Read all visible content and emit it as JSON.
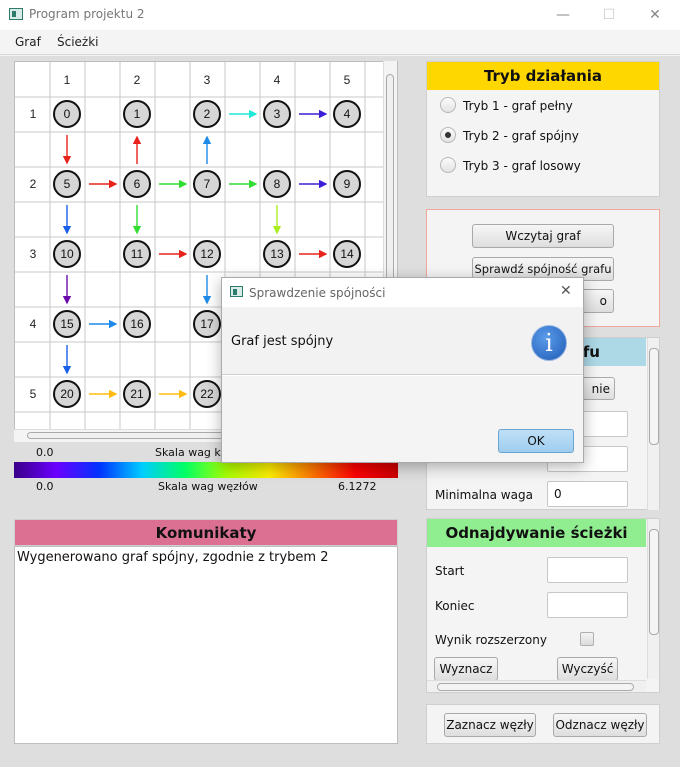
{
  "window": {
    "title": "Program projektu 2",
    "minimize": "—",
    "maximize": "☐",
    "close": "✕"
  },
  "menu": {
    "items": [
      "Graf",
      "Ścieżki"
    ]
  },
  "graph": {
    "col_labels": [
      "1",
      "2",
      "3",
      "4",
      "5"
    ],
    "row_labels": [
      "1",
      "2",
      "3",
      "4",
      "5"
    ],
    "nodes": [
      "0",
      "1",
      "2",
      "3",
      "4",
      "5",
      "6",
      "7",
      "8",
      "9",
      "10",
      "11",
      "12",
      "13",
      "14",
      "15",
      "16",
      "17",
      "20",
      "21",
      "22"
    ],
    "edge_colors": {
      "red": "#e8231b",
      "cyan": "#20e8d8",
      "indigo": "#3a1fd8",
      "green": "#33dd33",
      "lime": "#aaee22",
      "blue": "#1a5fe8",
      "purple": "#6a0aaa",
      "azure": "#1f8ae8",
      "yellow": "#ffbb11"
    }
  },
  "scales": {
    "edge_min": "0.0",
    "edge_label": "Skala wag krawędzi",
    "node_min": "0.0",
    "node_label": "Skala wag węzłów",
    "node_max": "6.1272"
  },
  "mode_panel": {
    "title": "Tryb działania",
    "options": [
      "Tryb 1 - graf pełny",
      "Tryb 2 - graf spójny",
      "Tryb 3 - graf losowy"
    ],
    "selected": "Tryb 2 - graf spójny",
    "header_color": "#ffd700"
  },
  "actions_panel": {
    "load": "Wczytaj graf",
    "check": "Sprawdź spójność grafu",
    "third": "o"
  },
  "params_panel": {
    "title_partial": "rafu",
    "button_partial": "nie",
    "min_weight_label": "Minimalna waga",
    "min_weight_value": "0",
    "header_color": "#add8e6"
  },
  "path_panel": {
    "title": "Odnajdywanie ścieżki",
    "start_label": "Start",
    "end_label": "Koniec",
    "extended_label": "Wynik rozszerzony",
    "find": "Wyznacz",
    "clear": "Wyczyść",
    "header_color": "#90ee90"
  },
  "nodes_panel": {
    "mark": "Zaznacz węzły",
    "unmark": "Odznacz węzły"
  },
  "messages": {
    "title": "Komunikaty",
    "text": "Wygenerowano graf spójny, zgodnie z trybem 2",
    "header_color": "#db7093"
  },
  "dialog": {
    "title": "Sprawdzenie spójności",
    "message": "Graf jest spójny",
    "ok": "OK",
    "icon": "i",
    "close": "✕"
  }
}
